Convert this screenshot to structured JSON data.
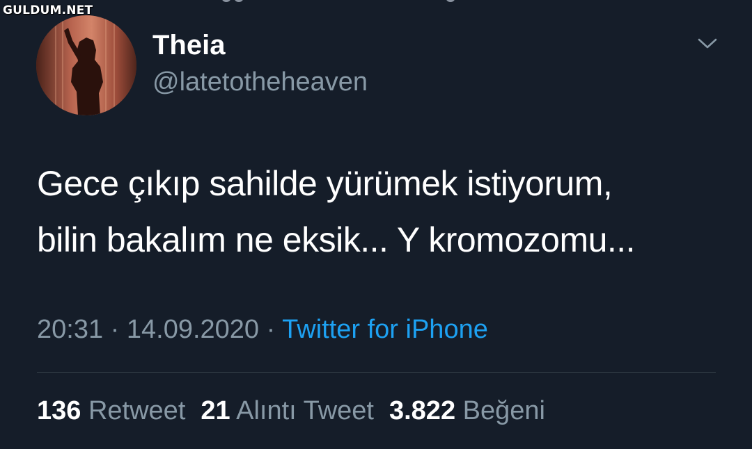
{
  "watermark": "GULDUM.NET",
  "author": {
    "display_name": "Theia",
    "handle": "@latetotheheaven",
    "avatar_icon": "avatar-silhouette-photo"
  },
  "menu": {
    "icon": "chevron-down-icon"
  },
  "tweet": {
    "lines": [
      "Gece çıkıp sahilde yürümek istiyorum,",
      "bilin bakalım ne eksik... Y kromozomu..."
    ]
  },
  "meta": {
    "time": "20:31",
    "separator": "·",
    "date": "14.09.2020",
    "source": "Twitter for iPhone"
  },
  "stats": {
    "retweets_count": "136",
    "retweets_label": "Retweet",
    "quotes_count": "21",
    "quotes_label": "Alıntı Tweet",
    "likes_count": "3.822",
    "likes_label": "Beğeni"
  },
  "colors": {
    "background": "#151d29",
    "secondary_text": "#8899a6",
    "link": "#1da1f2",
    "divider": "#38444d"
  }
}
